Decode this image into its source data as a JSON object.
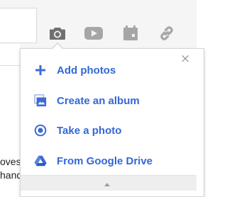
{
  "background_text": {
    "line1": "oves",
    "line2": "hand"
  },
  "toolbar": {
    "icons": [
      "camera-icon",
      "video-icon",
      "calendar-icon",
      "link-icon"
    ],
    "active_color": "#6f6f6f",
    "inactive_color": "#a3a3a3"
  },
  "popover": {
    "close_label": "×",
    "items": [
      {
        "label": "Add photos",
        "icon": "plus-icon"
      },
      {
        "label": "Create an album",
        "icon": "album-icon"
      },
      {
        "label": "Take a photo",
        "icon": "take-photo-icon"
      },
      {
        "label": "From Google Drive",
        "icon": "google-drive-icon"
      }
    ],
    "accent_color": "#3367d6"
  }
}
